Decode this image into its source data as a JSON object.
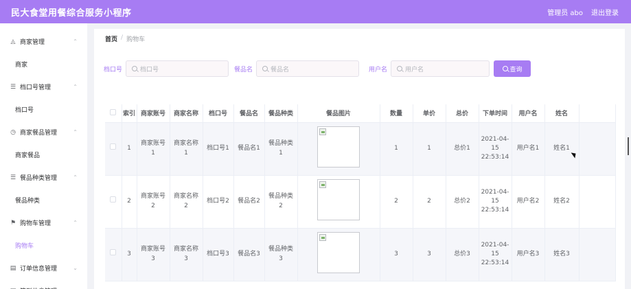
{
  "header": {
    "title": "民大食堂用餐综合服务小程序",
    "user_label": "管理员 abo",
    "logout_label": "退出登录"
  },
  "sidebar": {
    "groups": [
      {
        "label": "商家管理",
        "icon": "bell-icon",
        "sub": "商家",
        "active": false
      },
      {
        "label": "档口号管理",
        "icon": "list-icon",
        "sub": "档口号",
        "active": false
      },
      {
        "label": "商家餐品管理",
        "icon": "compass-icon",
        "sub": "商家餐品",
        "active": false
      },
      {
        "label": "餐品种类管理",
        "icon": "list-icon",
        "sub": "餐品种类",
        "active": false
      },
      {
        "label": "购物车管理",
        "icon": "flag-icon",
        "sub": "购物车",
        "active": true
      },
      {
        "label": "订单信息管理",
        "icon": "document-icon",
        "sub": null,
        "active": false
      },
      {
        "label": "签到信息管理",
        "icon": "document-icon",
        "sub": null,
        "active": false
      }
    ]
  },
  "breadcrumb": {
    "home": "首页",
    "separator": "/",
    "current": "购物车"
  },
  "filters": {
    "stall_label": "档口号",
    "stall_placeholder": "档口号",
    "dish_label": "餐品名",
    "dish_placeholder": "餐品名",
    "user_label": "用户名",
    "user_placeholder": "用户名",
    "query_label": "查询"
  },
  "table": {
    "headers": [
      "索引",
      "商家账号",
      "商家名称",
      "档口号",
      "餐品名",
      "餐品种类",
      "餐品图片",
      "数量",
      "单价",
      "总价",
      "下单时间",
      "用户名",
      "姓名"
    ],
    "rows": [
      {
        "index": "1",
        "account": "商家账号1",
        "name": "商家名称1",
        "stall": "档口号1",
        "dish": "餐品名1",
        "category": "餐品种类1",
        "qty": "1",
        "price": "1",
        "total": "总价1",
        "time": "2021-04-15 22:53:14",
        "username": "用户名1",
        "realname": "姓名1"
      },
      {
        "index": "2",
        "account": "商家账号2",
        "name": "商家名称2",
        "stall": "档口号2",
        "dish": "餐品名2",
        "category": "餐品种类2",
        "qty": "2",
        "price": "2",
        "total": "总价2",
        "time": "2021-04-15 22:53:14",
        "username": "用户名2",
        "realname": "姓名2"
      },
      {
        "index": "3",
        "account": "商家账号3",
        "name": "商家名称3",
        "stall": "档口号3",
        "dish": "餐品名3",
        "category": "餐品种类3",
        "qty": "3",
        "price": "3",
        "total": "总价3",
        "time": "2021-04-15 22:53:14",
        "username": "用户名3",
        "realname": "姓名3"
      }
    ]
  },
  "colors": {
    "accent": "#a77cf3",
    "row_stripe": "#f5f6fa"
  }
}
